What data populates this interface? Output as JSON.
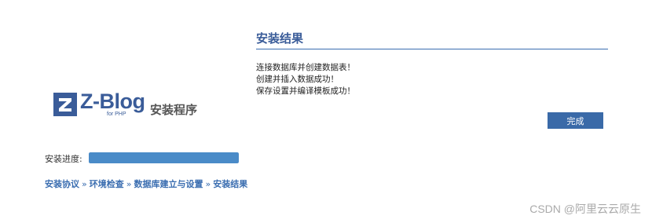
{
  "logo": {
    "brand": "Z-Blog",
    "sub": "for PHP"
  },
  "installer": {
    "title": "安装程序"
  },
  "progress": {
    "label": "安装进度:",
    "value": 1.0
  },
  "steps": [
    "安装协议",
    "环境检查",
    "数据库建立与设置",
    "安装结果"
  ],
  "step_separator": "»",
  "result": {
    "title": "安装结果",
    "messages": [
      "连接数据库并创建数据表！",
      "创建并插入数据成功！",
      "保存设置并编译模板成功！"
    ],
    "finish_label": "完成"
  },
  "watermark": "CSDN @阿里云云原生",
  "colors": {
    "accent": "#3a5c99",
    "progress": "#4a8bc8",
    "button": "#3a6aa8"
  }
}
